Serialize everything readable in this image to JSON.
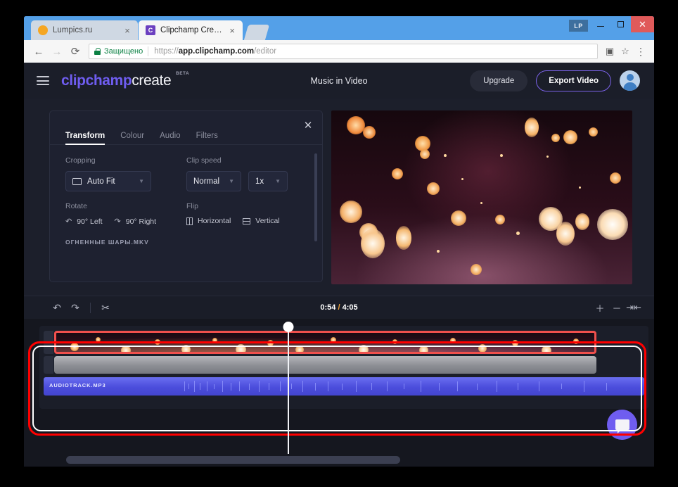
{
  "browser": {
    "tabs": [
      {
        "title": "Lumpics.ru",
        "favicon": "orange-circle-icon",
        "active": false,
        "close_label": "×"
      },
      {
        "title": "Clipchamp Create",
        "favicon": "clipchamp-c-icon",
        "favicon_letter": "C",
        "active": true,
        "close_label": "×"
      }
    ],
    "new_tab_name": "new-tab-button",
    "window_badge": "LP",
    "nav": {
      "back": "←",
      "forward": "→",
      "reload": "⟳"
    },
    "omnibox": {
      "secure_label": "Защищено",
      "url_scheme": "https://",
      "url_host": "app.clipchamp.com",
      "url_path": "/editor"
    },
    "menu_dots": "⋮"
  },
  "app": {
    "logo": {
      "brand": "clipchamp",
      "product": "create",
      "tag": "BETA"
    },
    "project_title": "Music in Video",
    "upgrade_label": "Upgrade",
    "export_label": "Export Video",
    "accent_purple": "#6f5df0",
    "accent_orange": "#f0a43a"
  },
  "properties_panel": {
    "close_label": "✕",
    "tabs": [
      {
        "label": "Transform",
        "active": true
      },
      {
        "label": "Colour",
        "active": false
      },
      {
        "label": "Audio",
        "active": false
      },
      {
        "label": "Filters",
        "active": false
      }
    ],
    "cropping": {
      "label": "Cropping",
      "value": "Auto Fit",
      "caret": "▼"
    },
    "clip_speed": {
      "label": "Clip speed",
      "mode": "Normal",
      "rate": "1x",
      "caret": "▼"
    },
    "rotate": {
      "label": "Rotate",
      "left": {
        "label": "90° Left",
        "icon": "rotate-left-icon",
        "glyph": "↶"
      },
      "right": {
        "label": "90° Right",
        "icon": "rotate-right-icon",
        "glyph": "↷"
      }
    },
    "flip": {
      "label": "Flip",
      "horizontal": "Horizontal",
      "vertical": "Vertical"
    },
    "clip_filename": "ОГНЕННЫЕ ШАРЫ.MKV"
  },
  "timeline_toolbar": {
    "undo": "↶",
    "redo": "↷",
    "split": "✂",
    "current_time": "0:54",
    "separator": " / ",
    "total_time": "4:05",
    "zoom_in": "＋",
    "zoom_out": "－",
    "zoom_fit": "⇥⇤"
  },
  "timeline": {
    "video_clip_name": "ОГНЕННЫЕ ШАРЫ.MKV",
    "audio_clip_name": "AUDIOTRACK.MP3",
    "selection_color": "#f0504d",
    "annotation_color": "#ff0000"
  },
  "chat": {
    "name": "support-chat-button"
  }
}
